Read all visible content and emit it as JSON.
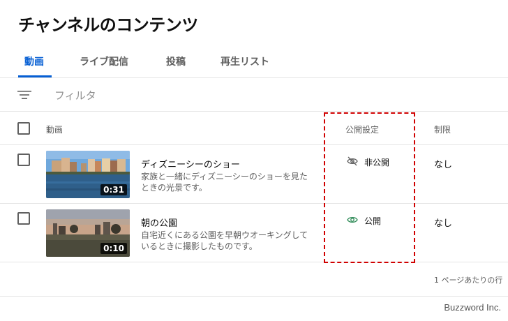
{
  "page": {
    "title": "チャンネルのコンテンツ"
  },
  "tabs": [
    {
      "label": "動画",
      "active": true
    },
    {
      "label": "ライブ配信",
      "active": false
    },
    {
      "label": "投稿",
      "active": false
    },
    {
      "label": "再生リスト",
      "active": false
    }
  ],
  "filter": {
    "icon": "filter-lines-icon",
    "placeholder": "フィルタ"
  },
  "table": {
    "headers": {
      "video": "動画",
      "visibility": "公開設定",
      "restrictions": "制限"
    },
    "rows": [
      {
        "title": "ディズニーシーのショー",
        "description": "家族と一緒にディズニーシーのショーを見たときの光景です。",
        "duration": "0:31",
        "visibility": "非公開",
        "visibility_icon": "eye-off-icon",
        "restriction": "なし"
      },
      {
        "title": "朝の公園",
        "description": "自宅近くにある公園を早朝ウオーキングしているときに撮影したものです。",
        "duration": "0:10",
        "visibility": "公開",
        "visibility_icon": "eye-icon",
        "restriction": "なし"
      }
    ]
  },
  "pagination": {
    "rows_per_page_label": "1 ページあたりの行"
  },
  "watermark": "Buzzword Inc.",
  "colors": {
    "accent": "#065fd4",
    "public_green": "#2e8b57",
    "highlight": "#d00000"
  }
}
